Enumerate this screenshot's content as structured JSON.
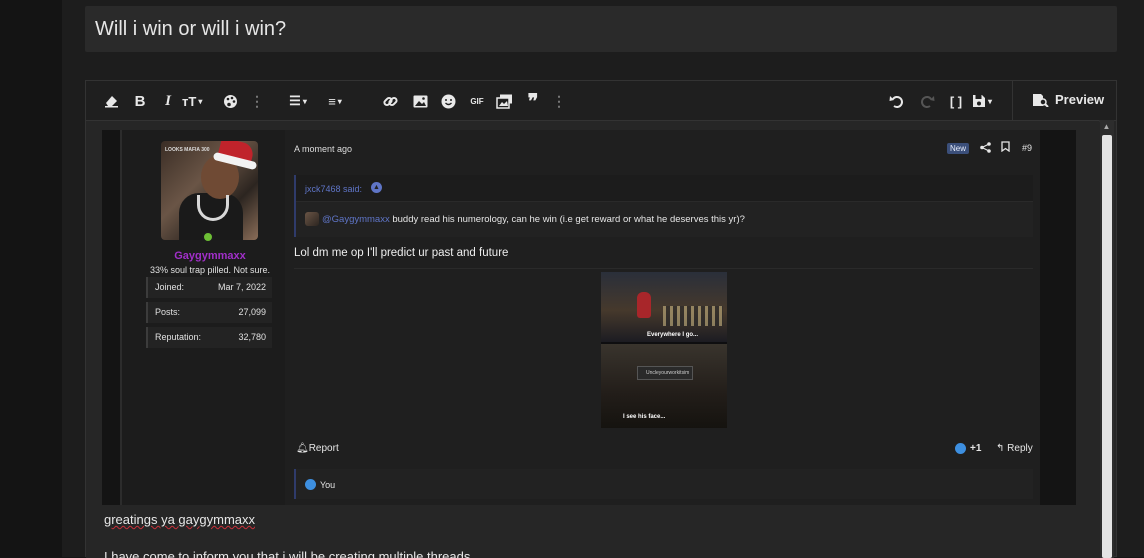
{
  "thread": {
    "title": "Will i win or will i win?"
  },
  "toolbar": {
    "preview_label": "Preview",
    "gif_label": "GIF",
    "quote_glyph": "❞"
  },
  "post": {
    "time": "A moment ago",
    "badge": "New",
    "number": "#9",
    "user": {
      "name": "Gaygymmaxx",
      "title": "33% soul trap pilled. Not sure.",
      "avatar_caption": "LOOKS MAFIA 300",
      "name_color": "#a12fc9",
      "stats": [
        {
          "key": "Joined:",
          "value": "Mar 7, 2022"
        },
        {
          "key": "Posts:",
          "value": "27,099"
        },
        {
          "key": "Reputation:",
          "value": "32,780"
        }
      ]
    },
    "quote": {
      "author": "jxck7468 said:",
      "mention": "@Gaygymmaxx",
      "text": " buddy read his numerology, can he win (i.e get reward or what he deserves this yr)?"
    },
    "message": "Lol dm me op I'll predict ur past and future",
    "meme": {
      "caption_top": "Everywhere I go...",
      "card_text": "Uncleyourworkitsim",
      "caption_bottom": "I see his face..."
    },
    "actions": {
      "report": "Report",
      "likes": "+1",
      "reply": "Reply"
    },
    "reactions_by": "You"
  },
  "editor_text": {
    "greeting": "greatings ya gaygymmaxx",
    "line2": "I have come to inform you that i will be creating multiple threads"
  }
}
